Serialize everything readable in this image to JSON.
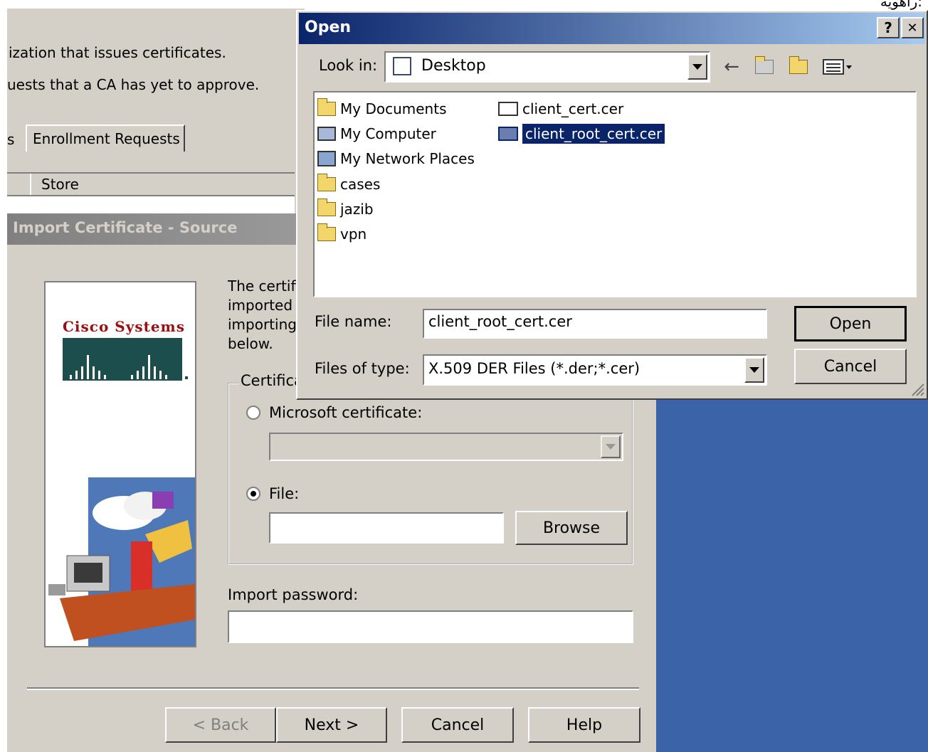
{
  "top_right_text": "راهویه:",
  "bg_window": {
    "desc_line1": "ization that issues certificates.",
    "desc_line2": "uests that a CA has yet to approve.",
    "tab_partial": "s",
    "tab_enrollment": "Enrollment Requests",
    "column_store": "Store"
  },
  "wizard": {
    "title": "Import Certificate - Source",
    "logo_text": "Cisco Systems",
    "intro_lines": [
      "The certifi",
      "imported fr",
      "importing i",
      "below."
    ],
    "group_label": "Certifica",
    "radio_microsoft": "Microsoft certificate:",
    "radio_file": "File:",
    "file_value": "",
    "browse": "Browse",
    "import_password_label": "Import password:",
    "import_password_value": "",
    "buttons": {
      "back": "< Back",
      "next": "Next >",
      "cancel": "Cancel",
      "help": "Help"
    }
  },
  "open_dialog": {
    "title": "Open",
    "help_btn": "?",
    "close_btn": "✕",
    "look_in_label": "Look in:",
    "look_in_value": "Desktop",
    "items_col1": [
      {
        "label": "My Documents",
        "icon": "my-documents-icon"
      },
      {
        "label": "My Computer",
        "icon": "my-computer-icon"
      },
      {
        "label": "My Network Places",
        "icon": "network-places-icon"
      },
      {
        "label": "cases",
        "icon": "folder-icon"
      },
      {
        "label": "jazib",
        "icon": "folder-icon"
      },
      {
        "label": "vpn",
        "icon": "folder-icon"
      }
    ],
    "items_col2": [
      {
        "label": "client_cert.cer",
        "icon": "certificate-icon",
        "selected": false
      },
      {
        "label": "client_root_cert.cer",
        "icon": "certificate-icon",
        "selected": true
      }
    ],
    "file_name_label": "File name:",
    "file_name_value": "client_root_cert.cer",
    "files_of_type_label": "Files of type:",
    "files_of_type_value": "X.509 DER Files (*.der;*.cer)",
    "open_btn": "Open",
    "cancel_btn": "Cancel"
  },
  "colors": {
    "dialog_face": "#d4d0c8",
    "title_bar": "#0a246a",
    "selection": "#0a246a",
    "desktop": "#3a63a8"
  }
}
